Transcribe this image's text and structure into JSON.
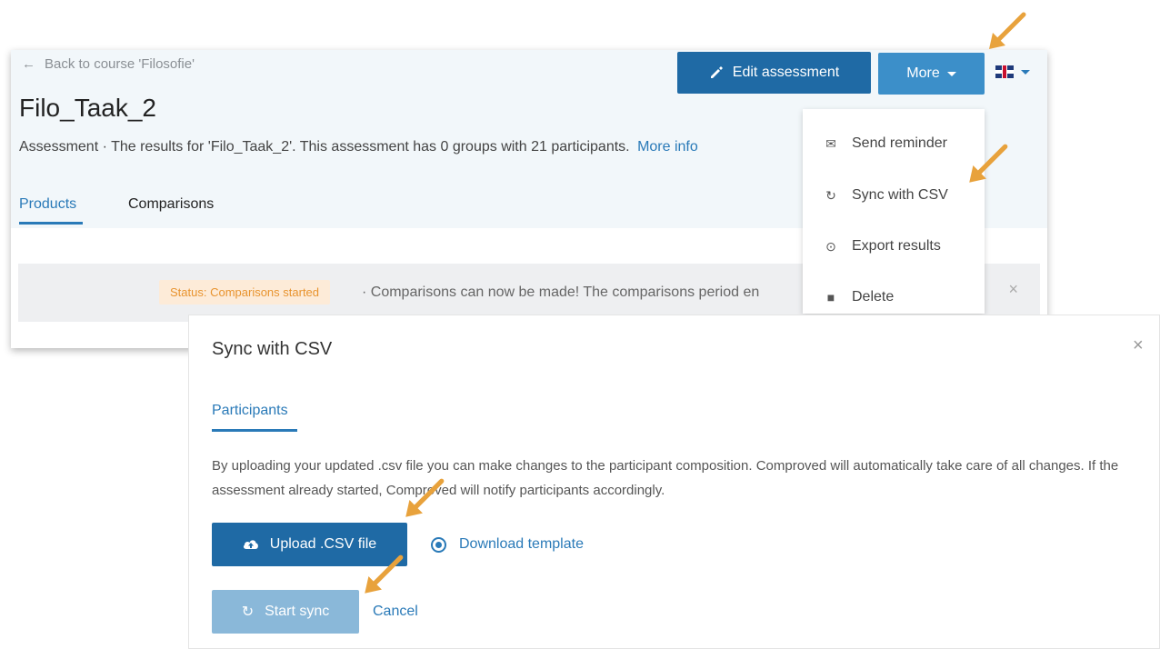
{
  "header": {
    "back_link": "Back to course 'Filosofie'",
    "title": "Filo_Taak_2",
    "description_prefix": "Assessment · The results for 'Filo_Taak_2'. This assessment has 0 groups with 21 participants.",
    "more_info_link": "More info",
    "edit_button": "Edit assessment",
    "more_button": "More",
    "language_icon": "uk-flag-icon"
  },
  "tabs": [
    "Products",
    "Comparisons"
  ],
  "status": {
    "badge": "Status: Comparisons started",
    "text": "· Comparisons can now be made! The comparisons period en"
  },
  "more_menu": [
    {
      "label": "Send reminder",
      "icon": "envelope-icon"
    },
    {
      "label": "Sync with CSV",
      "icon": "sync-icon"
    },
    {
      "label": "Export results",
      "icon": "export-icon"
    },
    {
      "label": "Delete",
      "icon": "trash-icon"
    }
  ],
  "sync_dialog": {
    "title": "Sync with CSV",
    "tab": "Participants",
    "body": "By uploading your updated .csv file you can make changes to the participant composition. Comproved will automatically take care of all changes. If the assessment already started, Comproved will notify participants accordingly.",
    "upload_button": "Upload .CSV file",
    "download_link": "Download template",
    "start_button": "Start sync",
    "cancel_link": "Cancel"
  },
  "colors": {
    "primary": "#1f6aa5",
    "secondary": "#3c8fc9",
    "link": "#2a7ab8",
    "annotation_arrow": "#e8a23c",
    "status_badge_bg": "#fdebd8",
    "status_badge_text": "#e8932e"
  }
}
